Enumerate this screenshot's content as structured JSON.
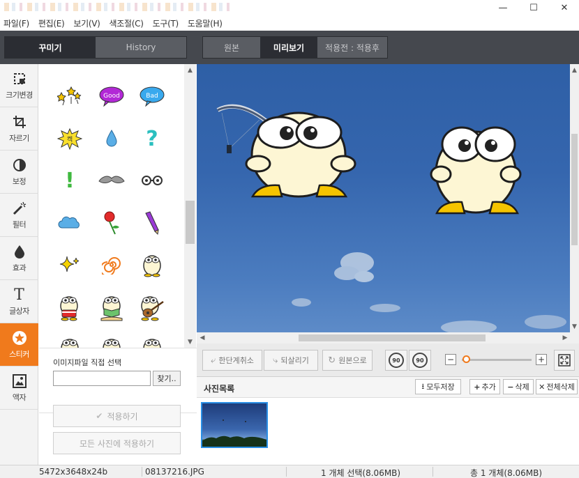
{
  "menu": [
    "파일(F)",
    "편집(E)",
    "보기(V)",
    "색조절(C)",
    "도구(T)",
    "도움말(H)"
  ],
  "panel_tabs": {
    "decorate": "꾸미기",
    "history": "History"
  },
  "view_tabs": {
    "original": "원본",
    "preview": "미리보기",
    "compare": "적용전 : 적용후"
  },
  "tools": [
    {
      "label": "크기변경",
      "icon": "resize-icon"
    },
    {
      "label": "자르기",
      "icon": "crop-icon"
    },
    {
      "label": "보정",
      "icon": "contrast-icon"
    },
    {
      "label": "필터",
      "icon": "magic-wand-icon"
    },
    {
      "label": "효과",
      "icon": "drop-icon"
    },
    {
      "label": "글상자",
      "icon": "text-icon"
    },
    {
      "label": "스티커",
      "icon": "star-icon"
    },
    {
      "label": "액자",
      "icon": "frame-icon"
    }
  ],
  "active_tool": "스티커",
  "stickers": [
    {
      "icon": "stars-sticker-icon"
    },
    {
      "icon": "good-bubble-sticker-icon",
      "text": "Good"
    },
    {
      "icon": "bad-bubble-sticker-icon",
      "text": "Bad"
    },
    {
      "icon": "burst-sticker-icon",
      "text": "켁"
    },
    {
      "icon": "water-drop-sticker-icon"
    },
    {
      "icon": "question-mark-sticker-icon"
    },
    {
      "icon": "exclamation-sticker-icon"
    },
    {
      "icon": "mustache-sticker-icon"
    },
    {
      "icon": "glasses-sticker-icon"
    },
    {
      "icon": "cloud-sticker-icon"
    },
    {
      "icon": "rose-sticker-icon"
    },
    {
      "icon": "pencil-sticker-icon"
    },
    {
      "icon": "sparkle-sticker-icon"
    },
    {
      "icon": "spiral-sticker-icon"
    },
    {
      "icon": "character-sticker-icon"
    },
    {
      "icon": "character-cake-sticker-icon"
    },
    {
      "icon": "character-book-sticker-icon"
    },
    {
      "icon": "character-guitar-sticker-icon"
    }
  ],
  "file_select": {
    "label": "이미지파일 직접 선택",
    "value": "",
    "browse": "찾기.."
  },
  "apply": {
    "apply": "적용하기",
    "apply_all": "모든 사진에 적용하기"
  },
  "edit_toolbar": {
    "undo": "한단계취소",
    "redo": "되살리기",
    "original": "원본으로",
    "rotate_left": "90",
    "rotate_right": "90"
  },
  "zoom_level": 0,
  "photo_list": {
    "title": "사진목록",
    "save_all": "모두저장",
    "add": "추가",
    "delete": "삭제",
    "delete_all": "전체삭제"
  },
  "status": {
    "dimensions": "5472x3648x24b",
    "filename": "08137216.JPG",
    "selection": "1 개체 선택(8.06MB)",
    "total": "총 1 개체(8.06MB)"
  },
  "colors": {
    "accent": "#f07a1c",
    "toolbar_dark": "#45484e",
    "sky": "#3566ae",
    "selection_border": "#2a8fe5"
  }
}
